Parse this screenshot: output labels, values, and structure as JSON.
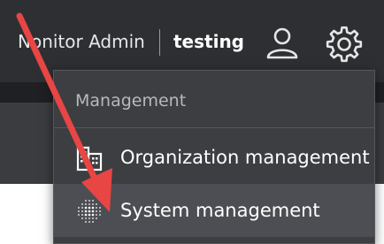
{
  "header": {
    "user_name": "Nonitor Admin",
    "org_name": "testing",
    "user_icon": "user-icon",
    "settings_icon": "gear-icon"
  },
  "menu": {
    "section_title": "Management",
    "items": [
      {
        "label": "Organization management",
        "icon": "building-icon"
      },
      {
        "label": "System management",
        "icon": "dot-grid-icon"
      }
    ]
  },
  "colors": {
    "topbar": "#2d2f33",
    "menu_bg": "#3c3e42",
    "menu_hover": "#4c4e53",
    "arrow": "#e84545"
  }
}
